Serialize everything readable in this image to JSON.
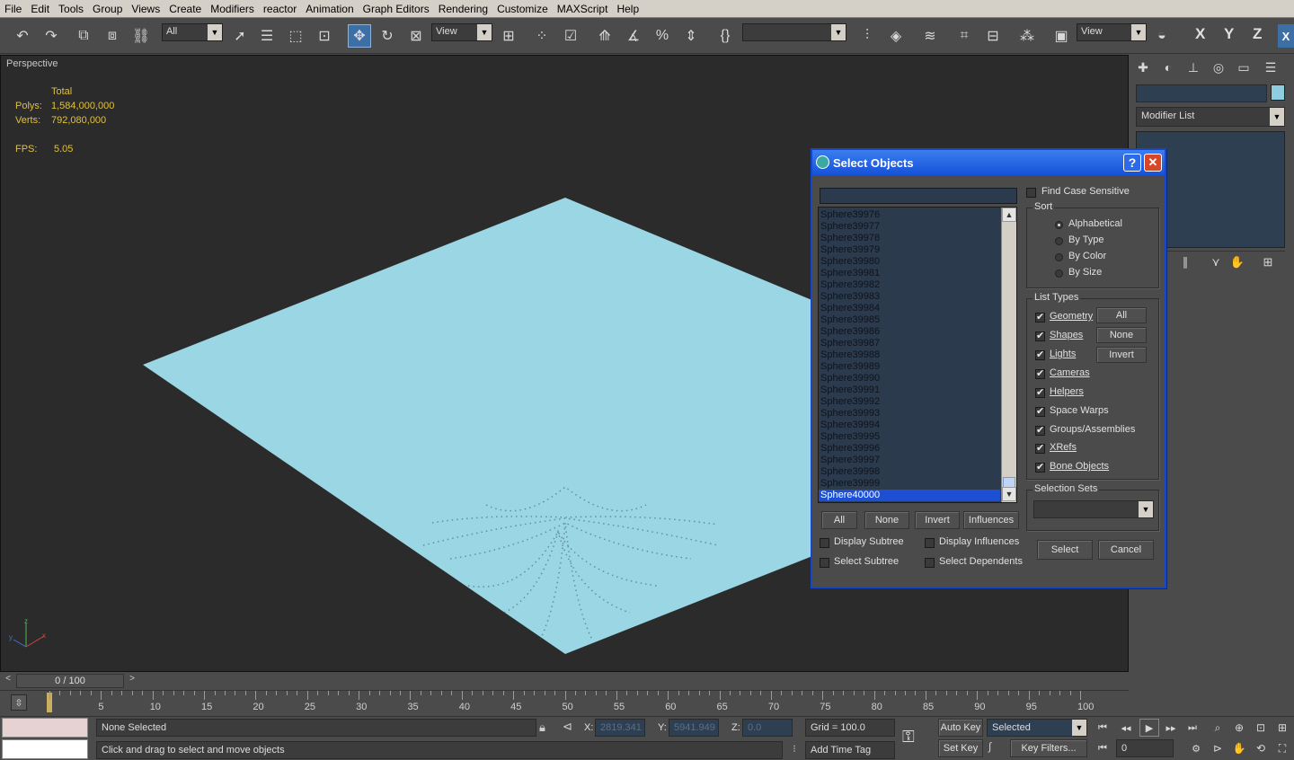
{
  "menubar": {
    "items": [
      "File",
      "Edit",
      "Tools",
      "Group",
      "Views",
      "Create",
      "Modifiers",
      "reactor",
      "Animation",
      "Graph Editors",
      "Rendering",
      "Customize",
      "MAXScript",
      "Help"
    ]
  },
  "toolbar": {
    "filter_value": "All",
    "ref_coord_1": "View",
    "named_sel": "",
    "ref_coord_2": "View",
    "axis_x": "X",
    "axis_y": "Y",
    "axis_z": "Z",
    "axis_close": "X"
  },
  "viewport": {
    "label": "Perspective",
    "stats": {
      "total_header": "Total",
      "polys_label": "Polys:",
      "polys_value": "1,584,000,000",
      "verts_label": "Verts:",
      "verts_value": "792,080,000",
      "fps_label": "FPS:",
      "fps_value": "5.05"
    },
    "plane_color": "#9ad6e3"
  },
  "command_panel": {
    "name_field": "",
    "modifier_list": "Modifier List",
    "color_swatch": "#8ecde0"
  },
  "dialog": {
    "title": "Select Objects",
    "search_value": "",
    "objects": [
      "Sphere39976",
      "Sphere39977",
      "Sphere39978",
      "Sphere39979",
      "Sphere39980",
      "Sphere39981",
      "Sphere39982",
      "Sphere39983",
      "Sphere39984",
      "Sphere39985",
      "Sphere39986",
      "Sphere39987",
      "Sphere39988",
      "Sphere39989",
      "Sphere39990",
      "Sphere39991",
      "Sphere39992",
      "Sphere39993",
      "Sphere39994",
      "Sphere39995",
      "Sphere39996",
      "Sphere39997",
      "Sphere39998",
      "Sphere39999",
      "Sphere40000"
    ],
    "selected_object": "Sphere40000",
    "find_case_sensitive": "Find Case Sensitive",
    "sort": {
      "title": "Sort",
      "options": [
        "Alphabetical",
        "By Type",
        "By Color",
        "By Size"
      ],
      "selected": "Alphabetical"
    },
    "list_types": {
      "title": "List Types",
      "items": [
        "Geometry",
        "Shapes",
        "Lights",
        "Cameras",
        "Helpers",
        "Space Warps",
        "Groups/Assemblies",
        "XRefs",
        "Bone Objects"
      ],
      "btn_all": "All",
      "btn_none": "None",
      "btn_invert": "Invert"
    },
    "selection_sets": {
      "title": "Selection Sets",
      "value": ""
    },
    "bottom_buttons": {
      "all": "All",
      "none": "None",
      "invert": "Invert",
      "influences": "Influences"
    },
    "options": {
      "display_subtree": "Display Subtree",
      "select_subtree": "Select Subtree",
      "display_influences": "Display Influences",
      "select_dependents": "Select Dependents"
    },
    "select": "Select",
    "cancel": "Cancel"
  },
  "timeline": {
    "frame_display": "0 / 100",
    "ticks": [
      "5",
      "10",
      "15",
      "20",
      "25",
      "30",
      "35",
      "40",
      "45",
      "50",
      "55",
      "60",
      "65",
      "70",
      "75",
      "80",
      "85",
      "90",
      "95",
      "100"
    ]
  },
  "status": {
    "selection": "None Selected",
    "prompt": "Click and drag to select and move objects",
    "x_label": "X:",
    "x_value": "2819.341",
    "y_label": "Y:",
    "y_value": "5941.949",
    "z_label": "Z:",
    "z_value": "0.0",
    "grid": "Grid = 100.0",
    "add_time_tag": "Add Time Tag",
    "auto_key": "Auto Key",
    "set_key": "Set Key",
    "key_mode_value": "Selected",
    "key_filters": "Key Filters...",
    "current_frame": "0"
  }
}
